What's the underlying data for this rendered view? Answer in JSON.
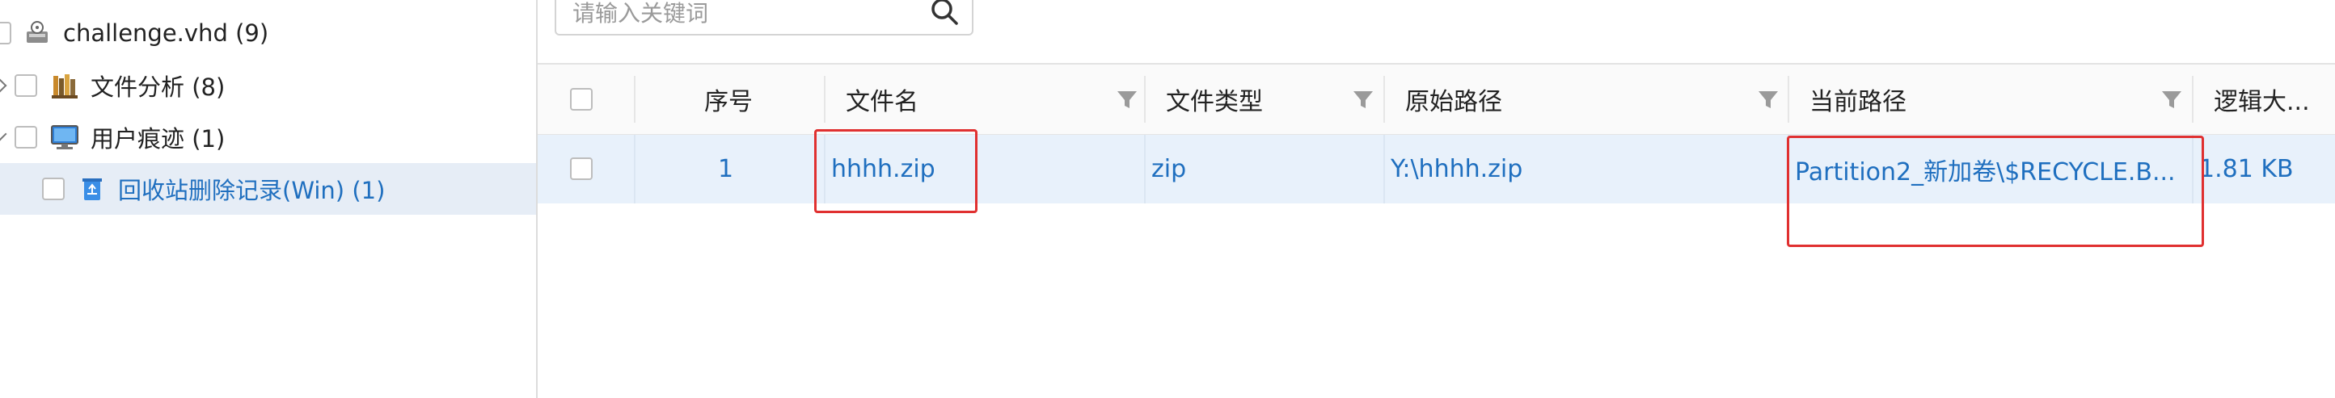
{
  "tree": {
    "items": [
      {
        "label": "challenge.vhd (9)",
        "icon": "disk-image-icon"
      },
      {
        "label": "文件分析 (8)",
        "icon": "file-analysis-icon"
      },
      {
        "label": "用户痕迹 (1)",
        "icon": "computer-icon"
      },
      {
        "label": "回收站删除记录(Win) (1)",
        "icon": "recycle-bin-icon"
      }
    ]
  },
  "search": {
    "placeholder": "请输入关键词"
  },
  "table": {
    "columns": [
      "序号",
      "文件名",
      "文件类型",
      "原始路径",
      "当前路径",
      "逻辑大..."
    ],
    "rows": [
      {
        "index": "1",
        "name": "hhhh.zip",
        "type": "zip",
        "original_path": "Y:\\hhhh.zip",
        "current_path": "Partition2_新加卷\\$RECYCLE.B...",
        "size": "1.81 KB"
      }
    ]
  },
  "colors": {
    "accent": "#1f6fbf",
    "selected_bg": "#e6edf6",
    "row_bg": "#e8f1fb",
    "highlight": "#e03030"
  }
}
